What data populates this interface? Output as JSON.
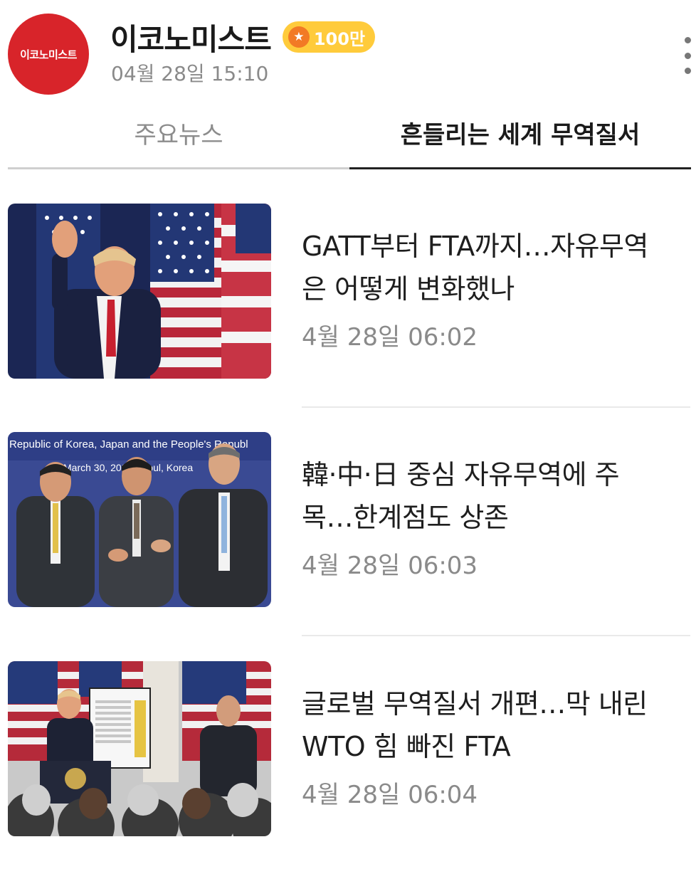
{
  "header": {
    "logo_text": "이코노미스트",
    "channel_name": "이코노미스트",
    "badge": "100만",
    "timestamp": "04월 28일 15:10",
    "more_icon": "more-vertical-icon"
  },
  "tabs": [
    {
      "label": "주요뉴스",
      "active": false
    },
    {
      "label": "흔들리는 세계 무역질서",
      "active": true
    }
  ],
  "articles": [
    {
      "title": "GATT부터 FTA까지…자유무역은 어떻게 변화했나",
      "date": "4월 28일 06:02",
      "image": "man waving in front of US flags"
    },
    {
      "title": "韓·中·日 중심 자유무역에 주목…한계점도 상존",
      "date": "4월 28일 06:03",
      "image": "three officials shaking hands",
      "image_text": [
        "Republic of Korea, Japan and the People's Republ",
        "March 30, 2025 Seoul, Korea"
      ]
    },
    {
      "title": "글로벌 무역질서 개편…막 내린 WTO 힘 빠진 FTA",
      "date": "4월 28일 06:04",
      "image": "speaker at podium with tariff chart"
    }
  ],
  "colors": {
    "brand_red": "#d8242a",
    "badge_yellow": "#ffcb3b",
    "badge_star_orange": "#f27a25",
    "active_tab_underline": "#222222"
  }
}
